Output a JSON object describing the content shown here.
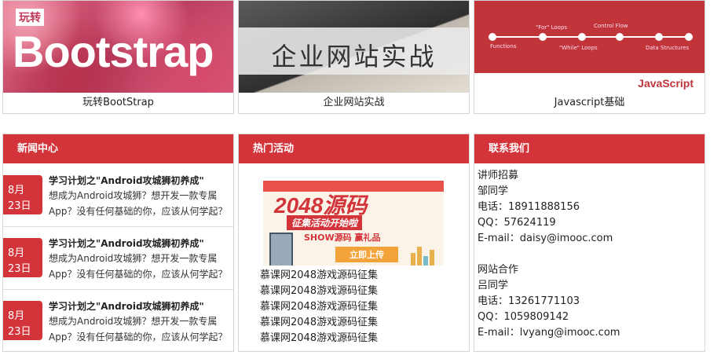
{
  "courses": [
    {
      "label": "玩转BootStrap",
      "thumb_tag": "玩转",
      "thumb_word": "Bootstrap"
    },
    {
      "label": "企业网站实战",
      "thumb_word": "企业网站实战"
    },
    {
      "label": "Javascript基础",
      "thumb_word": "JavaScript",
      "roadmap": [
        "\"For\" Loops",
        "Control Flow",
        "Functions",
        "\"While\" Loops",
        "Data Structures"
      ]
    }
  ],
  "news": {
    "title": "新闻中心",
    "items": [
      {
        "month": "8月",
        "day": "23日",
        "title": "学习计划之\"Android攻城狮初养成\"",
        "desc": "想成为Android攻城狮？想开发一款专属App？没有任何基础的你，应该从何学起？"
      },
      {
        "month": "8月",
        "day": "23日",
        "title": "学习计划之\"Android攻城狮初养成\"",
        "desc": "想成为Android攻城狮？想开发一款专属App？没有任何基础的你，应该从何学起？"
      },
      {
        "month": "8月",
        "day": "23日",
        "title": "学习计划之\"Android攻城狮初养成\"",
        "desc": "想成为Android攻城狮？想开发一款专属App？没有任何基础的你，应该从何学起？"
      }
    ]
  },
  "activities": {
    "title": "热门活动",
    "banner": {
      "headline": "2048源码",
      "subline": "征集活动开始啦",
      "show": "SHOW源码  赢礼品",
      "button": "立即上传"
    },
    "items": [
      "慕课网2048游戏源码征集",
      "慕课网2048游戏源码征集",
      "慕课网2048游戏源码征集",
      "慕课网2048游戏源码征集",
      "慕课网2048游戏源码征集"
    ]
  },
  "contact": {
    "title": "联系我们",
    "lines_a": [
      "讲师招募",
      "邹同学",
      "电话：18911888156",
      "QQ：57624119",
      "E-mail：daisy@imooc.com"
    ],
    "lines_b": [
      "网站合作",
      "吕同学",
      "电话：13261771103",
      "QQ：1059809142",
      "E-mail：lvyang@imooc.com"
    ]
  }
}
